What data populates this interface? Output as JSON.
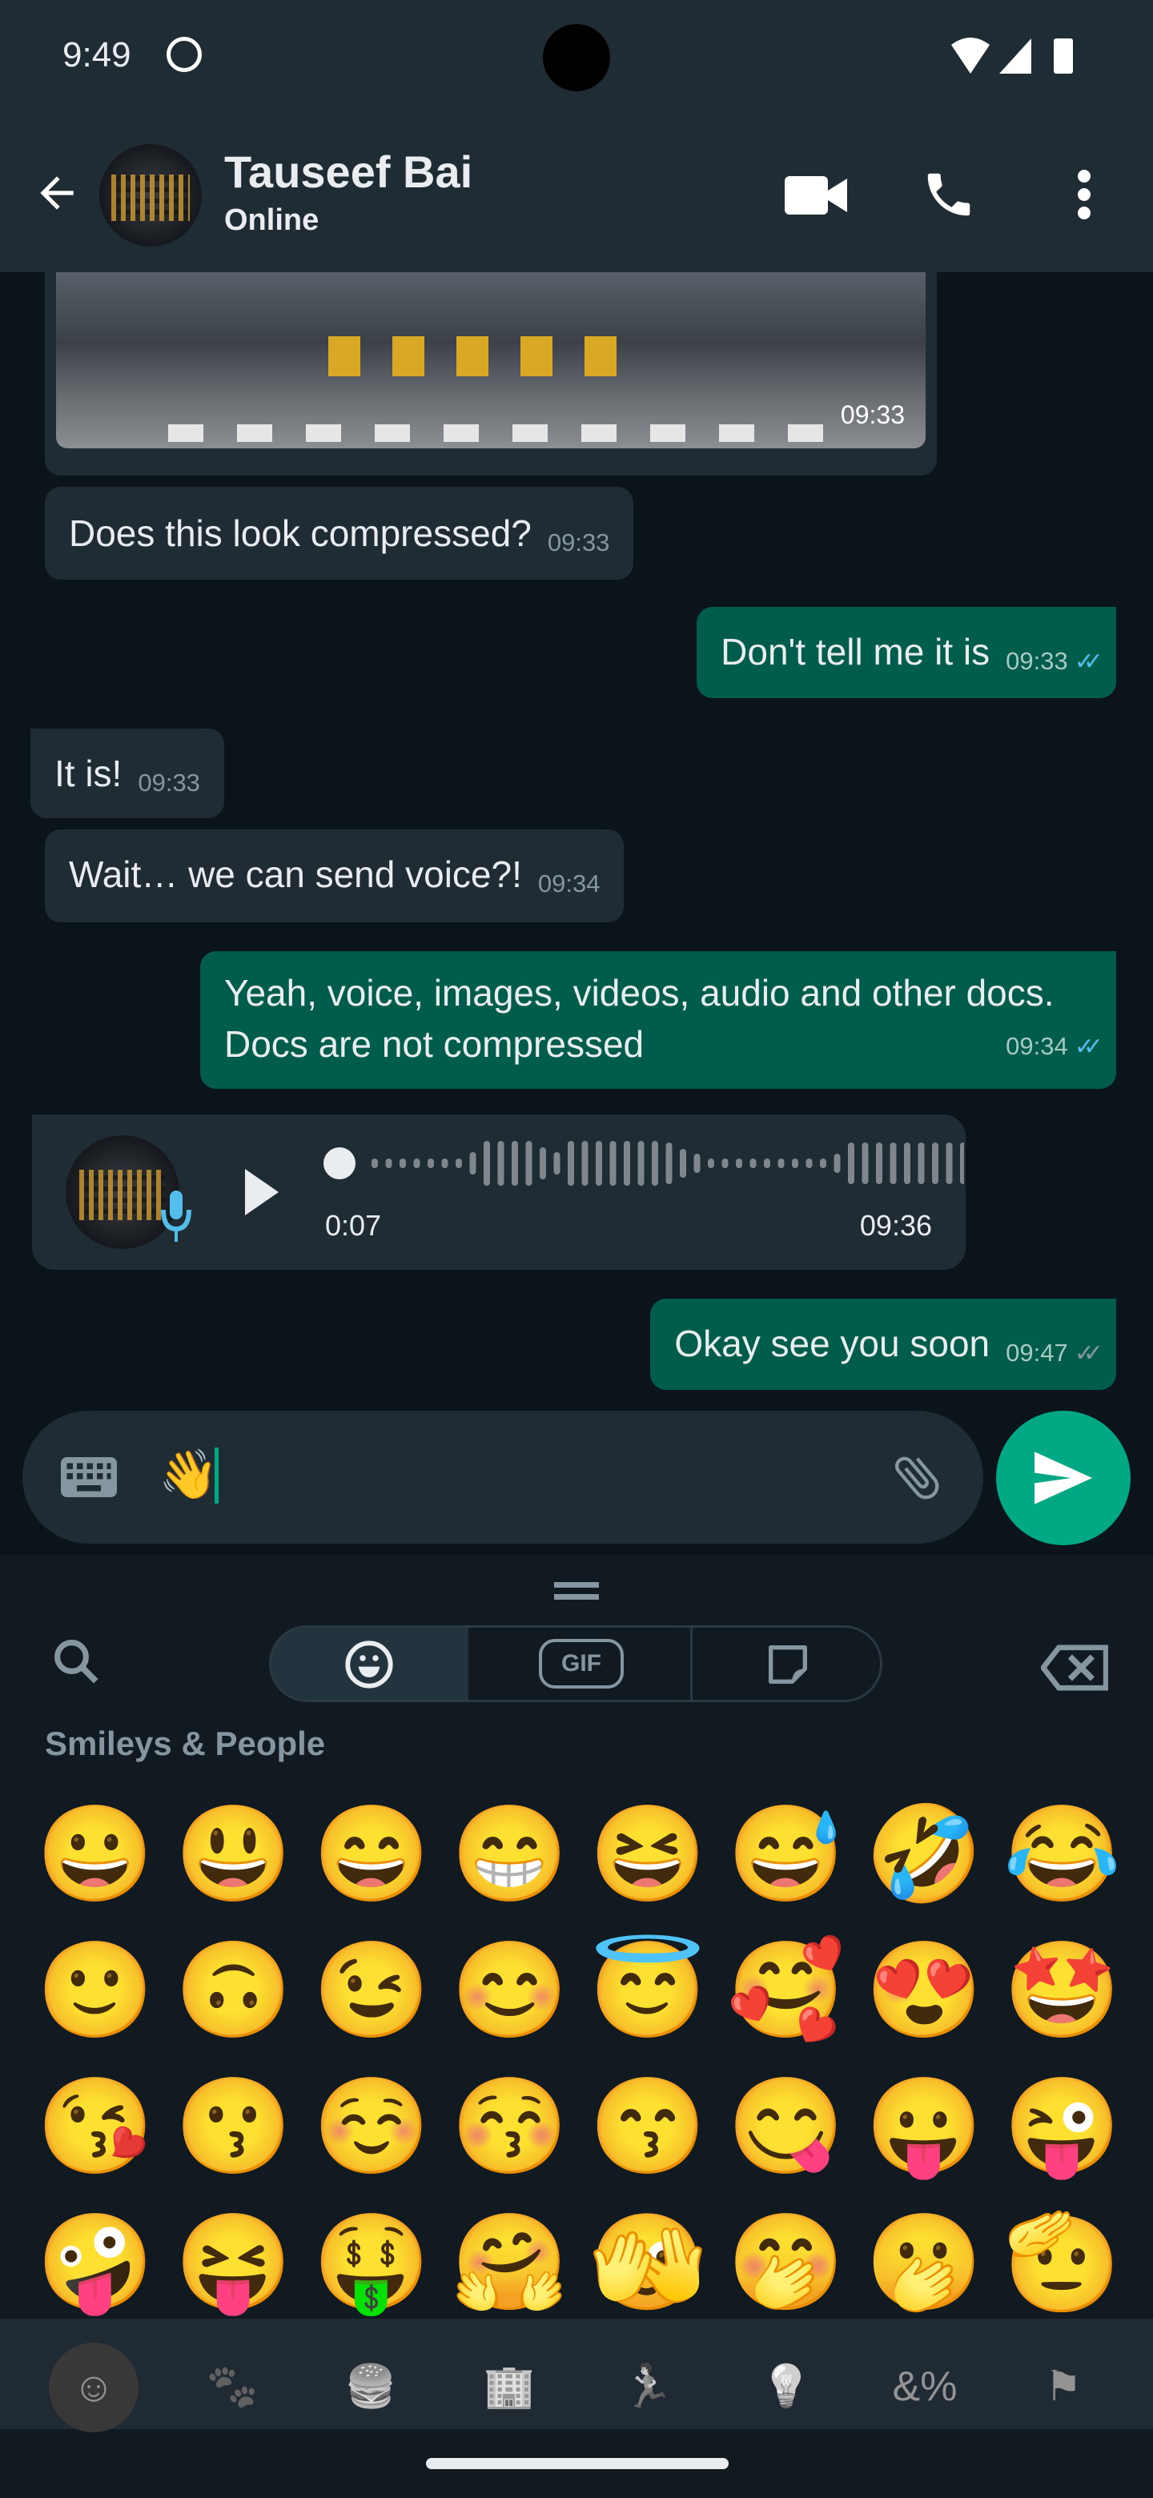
{
  "status": {
    "time": "9:49"
  },
  "header": {
    "contact_name": "Tauseef Bai",
    "presence": "Online"
  },
  "messages": [
    {
      "type": "image",
      "time": "09:33"
    },
    {
      "type": "text",
      "dir": "in",
      "text": "Does this look compressed?",
      "time": "09:33"
    },
    {
      "type": "text",
      "dir": "out",
      "text": "Don't tell me it is",
      "time": "09:33",
      "read": true
    },
    {
      "type": "text",
      "dir": "in",
      "text": "It is!",
      "time": "09:33"
    },
    {
      "type": "text",
      "dir": "in",
      "text": "Wait… we can send voice?!",
      "time": "09:34"
    },
    {
      "type": "text",
      "dir": "out",
      "text": "Yeah, voice, images, videos, audio and other docs. Docs are not compressed",
      "time": "09:34",
      "read": true
    },
    {
      "type": "voice",
      "dir": "in",
      "duration": "0:07",
      "time": "09:36",
      "progress": 0
    },
    {
      "type": "text",
      "dir": "out",
      "text": "Okay see you soon",
      "time": "09:47",
      "read": false
    }
  ],
  "composer": {
    "value": "👋"
  },
  "keyboard": {
    "tabs": {
      "gif": "GIF",
      "active": "emoji"
    },
    "section_title": "Smileys & People",
    "emojis": [
      "😀",
      "😃",
      "😄",
      "😁",
      "😆",
      "😅",
      "🤣",
      "😂",
      "🙂",
      "🙃",
      "😉",
      "😊",
      "😇",
      "🥰",
      "😍",
      "🤩",
      "😘",
      "😗",
      "☺️",
      "😚",
      "😙",
      "😋",
      "😛",
      "😜",
      "🤪",
      "😝",
      "🤑",
      "🤗",
      "🫣",
      "🤭",
      "🫢",
      "🫡"
    ],
    "categories": [
      "smileys",
      "animals",
      "food",
      "travel",
      "activities",
      "objects",
      "symbols",
      "flags"
    ],
    "active_category": "smileys"
  },
  "colors": {
    "header": "#1f2c34",
    "chat_bg": "#0b141a",
    "incoming": "#1f2c34",
    "outgoing": "#005c4b",
    "accent": "#00a884",
    "read_tick": "#53bdeb"
  }
}
